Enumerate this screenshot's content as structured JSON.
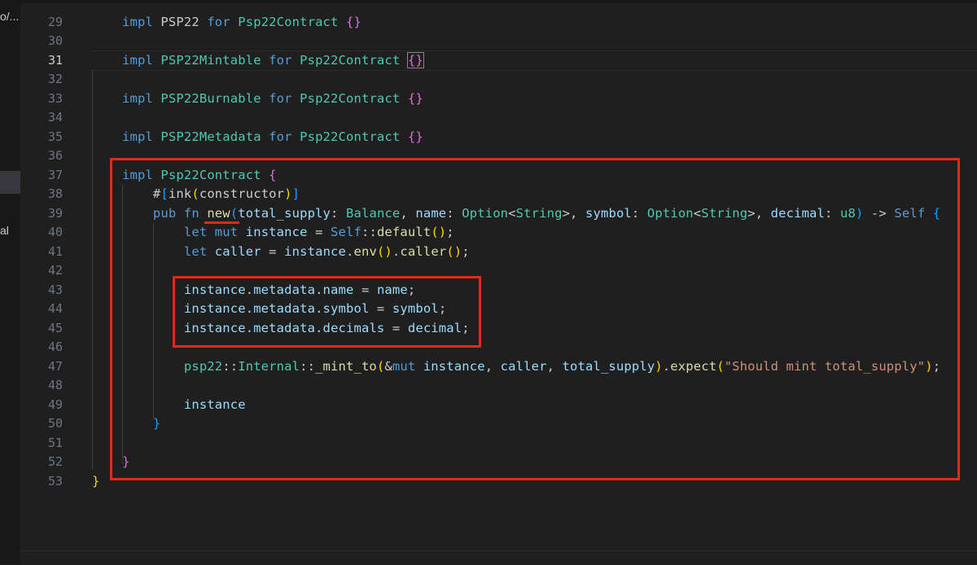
{
  "sidebar": {
    "fragments": [
      "o/...",
      "al"
    ]
  },
  "active_line": "31",
  "lines": [
    {
      "n": "29",
      "tokens": [
        [
          "kw",
          "impl"
        ],
        [
          "pl",
          " PSP22 "
        ],
        [
          "kw",
          "for"
        ],
        [
          "pl",
          " "
        ],
        [
          "ty",
          "Psp22Contract"
        ],
        [
          "pl",
          " "
        ],
        [
          "b2",
          "{}"
        ]
      ]
    },
    {
      "n": "30",
      "tokens": []
    },
    {
      "n": "31",
      "tokens": [
        [
          "kw",
          "impl"
        ],
        [
          "pl",
          " "
        ],
        [
          "ty",
          "PSP22Mintable"
        ],
        [
          "pl",
          " "
        ],
        [
          "kw",
          "for"
        ],
        [
          "pl",
          " "
        ],
        [
          "ty",
          "Psp22Contract"
        ],
        [
          "pl",
          " "
        ],
        [
          "b2m",
          "{}"
        ]
      ]
    },
    {
      "n": "32",
      "tokens": []
    },
    {
      "n": "33",
      "tokens": [
        [
          "kw",
          "impl"
        ],
        [
          "pl",
          " "
        ],
        [
          "ty",
          "PSP22Burnable"
        ],
        [
          "pl",
          " "
        ],
        [
          "kw",
          "for"
        ],
        [
          "pl",
          " "
        ],
        [
          "ty",
          "Psp22Contract"
        ],
        [
          "pl",
          " "
        ],
        [
          "b2",
          "{}"
        ]
      ]
    },
    {
      "n": "34",
      "tokens": []
    },
    {
      "n": "35",
      "tokens": [
        [
          "kw",
          "impl"
        ],
        [
          "pl",
          " "
        ],
        [
          "ty",
          "PSP22Metadata"
        ],
        [
          "pl",
          " "
        ],
        [
          "kw",
          "for"
        ],
        [
          "pl",
          " "
        ],
        [
          "ty",
          "Psp22Contract"
        ],
        [
          "pl",
          " "
        ],
        [
          "b2",
          "{}"
        ]
      ]
    },
    {
      "n": "36",
      "tokens": []
    },
    {
      "n": "37",
      "tokens": [
        [
          "kw",
          "impl"
        ],
        [
          "pl",
          " "
        ],
        [
          "ty",
          "Psp22Contract"
        ],
        [
          "pl",
          " "
        ],
        [
          "b2",
          "{"
        ]
      ]
    },
    {
      "n": "38",
      "tokens": [
        [
          "pl",
          "    #"
        ],
        [
          "b3",
          "["
        ],
        [
          "pl",
          "ink"
        ],
        [
          "b1",
          "("
        ],
        [
          "pl",
          "constructor"
        ],
        [
          "b1",
          ")"
        ],
        [
          "b3",
          "]"
        ]
      ]
    },
    {
      "n": "39",
      "tokens": [
        [
          "kw",
          "    pub"
        ],
        [
          "pl",
          " "
        ],
        [
          "kw",
          "fn"
        ],
        [
          "pl",
          " "
        ],
        [
          "fn",
          "new"
        ],
        [
          "b3",
          "("
        ],
        [
          "vr",
          "total_supply"
        ],
        [
          "pl",
          ": "
        ],
        [
          "ty",
          "Balance"
        ],
        [
          "pl",
          ", "
        ],
        [
          "vr",
          "name"
        ],
        [
          "pl",
          ": "
        ],
        [
          "ty",
          "Option"
        ],
        [
          "pl",
          "<"
        ],
        [
          "ty",
          "String"
        ],
        [
          "pl",
          ">, "
        ],
        [
          "vr",
          "symbol"
        ],
        [
          "pl",
          ": "
        ],
        [
          "ty",
          "Option"
        ],
        [
          "pl",
          "<"
        ],
        [
          "ty",
          "String"
        ],
        [
          "pl",
          ">, "
        ],
        [
          "vr",
          "decimal"
        ],
        [
          "pl",
          ": "
        ],
        [
          "ty",
          "u8"
        ],
        [
          "b3",
          ")"
        ],
        [
          "pl",
          " -> "
        ],
        [
          "kw",
          "Self"
        ],
        [
          "pl",
          " "
        ],
        [
          "b3",
          "{"
        ]
      ]
    },
    {
      "n": "40",
      "tokens": [
        [
          "kw",
          "        let"
        ],
        [
          "pl",
          " "
        ],
        [
          "kw",
          "mut"
        ],
        [
          "pl",
          " "
        ],
        [
          "vr",
          "instance"
        ],
        [
          "pl",
          " = "
        ],
        [
          "kw",
          "Self"
        ],
        [
          "pl",
          "::"
        ],
        [
          "fn",
          "default"
        ],
        [
          "b1",
          "()"
        ],
        [
          "pl",
          ";"
        ]
      ]
    },
    {
      "n": "41",
      "tokens": [
        [
          "kw",
          "        let"
        ],
        [
          "pl",
          " "
        ],
        [
          "vr",
          "caller"
        ],
        [
          "pl",
          " = "
        ],
        [
          "vr",
          "instance"
        ],
        [
          "pl",
          "."
        ],
        [
          "fn",
          "env"
        ],
        [
          "b1",
          "()"
        ],
        [
          "pl",
          "."
        ],
        [
          "fn",
          "caller"
        ],
        [
          "b1",
          "()"
        ],
        [
          "pl",
          ";"
        ]
      ]
    },
    {
      "n": "42",
      "tokens": []
    },
    {
      "n": "43",
      "tokens": [
        [
          "vr",
          "        instance"
        ],
        [
          "pl",
          "."
        ],
        [
          "vr",
          "metadata"
        ],
        [
          "pl",
          "."
        ],
        [
          "vr",
          "name"
        ],
        [
          "pl",
          " = "
        ],
        [
          "vr",
          "name"
        ],
        [
          "pl",
          ";"
        ]
      ]
    },
    {
      "n": "44",
      "tokens": [
        [
          "vr",
          "        instance"
        ],
        [
          "pl",
          "."
        ],
        [
          "vr",
          "metadata"
        ],
        [
          "pl",
          "."
        ],
        [
          "vr",
          "symbol"
        ],
        [
          "pl",
          " = "
        ],
        [
          "vr",
          "symbol"
        ],
        [
          "pl",
          ";"
        ]
      ]
    },
    {
      "n": "45",
      "tokens": [
        [
          "vr",
          "        instance"
        ],
        [
          "pl",
          "."
        ],
        [
          "vr",
          "metadata"
        ],
        [
          "pl",
          "."
        ],
        [
          "vr",
          "decimals"
        ],
        [
          "pl",
          " = "
        ],
        [
          "vr",
          "decimal"
        ],
        [
          "pl",
          ";"
        ]
      ]
    },
    {
      "n": "46",
      "tokens": []
    },
    {
      "n": "47",
      "tokens": [
        [
          "ty",
          "        psp22"
        ],
        [
          "pl",
          "::"
        ],
        [
          "ty",
          "Internal"
        ],
        [
          "pl",
          "::"
        ],
        [
          "fn",
          "_mint_to"
        ],
        [
          "b1",
          "("
        ],
        [
          "pl",
          "&"
        ],
        [
          "kw",
          "mut"
        ],
        [
          "pl",
          " "
        ],
        [
          "vr",
          "instance"
        ],
        [
          "pl",
          ", "
        ],
        [
          "vr",
          "caller"
        ],
        [
          "pl",
          ", "
        ],
        [
          "vr",
          "total_supply"
        ],
        [
          "b1",
          ")"
        ],
        [
          "pl",
          "."
        ],
        [
          "fn",
          "expect"
        ],
        [
          "b1",
          "("
        ],
        [
          "st",
          "\"Should mint total_supply\""
        ],
        [
          "b1",
          ")"
        ],
        [
          "pl",
          ";"
        ]
      ]
    },
    {
      "n": "48",
      "tokens": []
    },
    {
      "n": "49",
      "tokens": [
        [
          "vr",
          "        instance"
        ]
      ]
    },
    {
      "n": "50",
      "tokens": [
        [
          "b3",
          "    }"
        ]
      ]
    },
    {
      "n": "51",
      "tokens": []
    },
    {
      "n": "52",
      "tokens": [
        [
          "b2",
          "}"
        ]
      ]
    },
    {
      "n": "53",
      "tokens": [
        [
          "b1m",
          "}"
        ]
      ]
    }
  ],
  "colors": {
    "highlight_box": "#e8261a",
    "editor_bg": "#1f1f1f",
    "keyword": "#569cd6",
    "type": "#4ec9b0"
  }
}
